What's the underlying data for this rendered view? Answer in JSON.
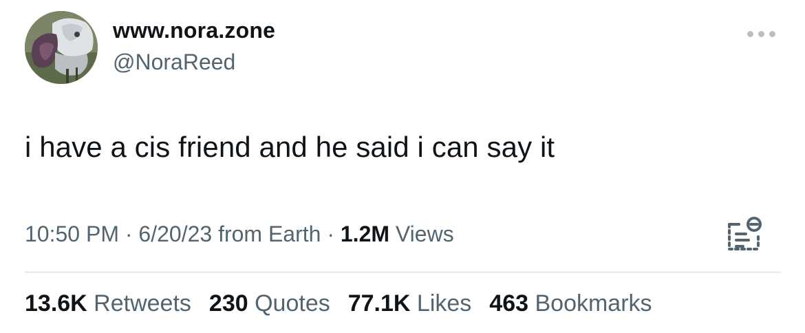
{
  "user": {
    "display_name": "www.nora.zone",
    "handle": "@NoraReed",
    "avatar_icon": "avatar-photo"
  },
  "tweet": {
    "text": "i have a cis friend and he said i can say it"
  },
  "meta": {
    "time": "10:50 PM",
    "sep1": " · ",
    "date": "6/20/23",
    "source": " from Earth",
    "sep2": " · ",
    "views_count": "1.2M",
    "views_label": " Views"
  },
  "stats": {
    "retweets_count": "13.6K",
    "retweets_label": " Retweets",
    "quotes_count": "230",
    "quotes_label": " Quotes",
    "likes_count": "77.1K",
    "likes_label": " Likes",
    "bookmarks_count": "463",
    "bookmarks_label": " Bookmarks"
  },
  "icons": {
    "more": "more-options-icon",
    "analytics": "view-analytics-icon"
  },
  "colors": {
    "text_primary": "#0f1419",
    "text_secondary": "#536471",
    "divider": "#cfd9de"
  }
}
